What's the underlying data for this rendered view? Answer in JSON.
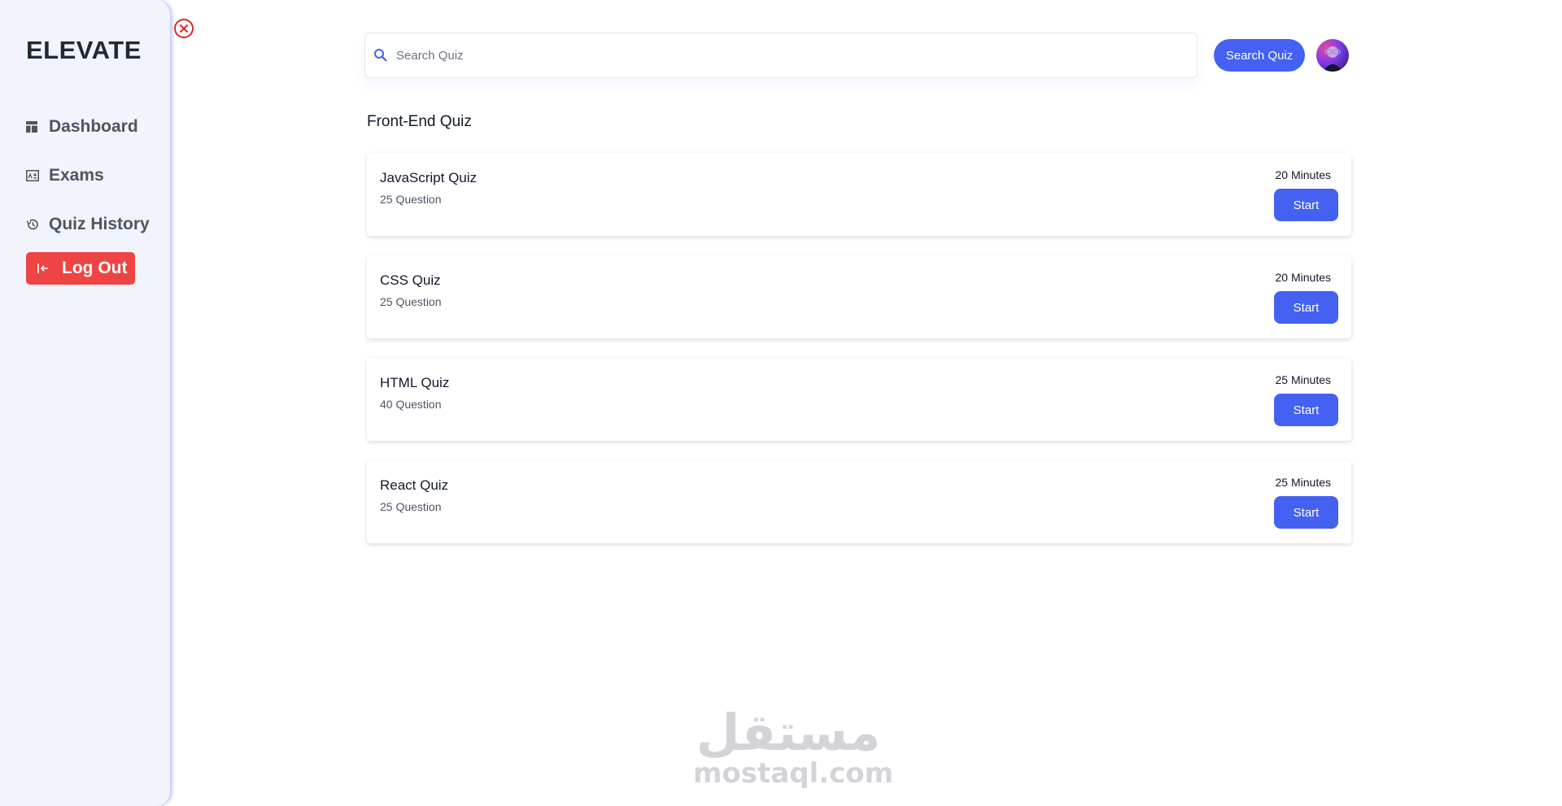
{
  "sidebar": {
    "logo": "ELEVATE",
    "items": [
      {
        "label": "Dashboard",
        "icon": "dashboard-icon"
      },
      {
        "label": "Exams",
        "icon": "exams-icon"
      },
      {
        "label": "Quiz History",
        "icon": "history-icon"
      }
    ],
    "logout": {
      "label": "Log Out",
      "icon": "logout-icon"
    }
  },
  "header": {
    "search_placeholder": "Search Quiz",
    "search_value": "",
    "search_button": "Search Quiz",
    "close_icon": "close-circle-icon"
  },
  "main": {
    "section_title": "Front-End Quiz",
    "quizzes": [
      {
        "name": "JavaScript Quiz",
        "questions": "25 Question",
        "duration": "20 Minutes",
        "action": "Start"
      },
      {
        "name": "CSS Quiz",
        "questions": "25 Question",
        "duration": "20 Minutes",
        "action": "Start"
      },
      {
        "name": "HTML Quiz",
        "questions": "40 Question",
        "duration": "25 Minutes",
        "action": "Start"
      },
      {
        "name": "React Quiz",
        "questions": "25 Question",
        "duration": "25 Minutes",
        "action": "Start"
      }
    ]
  },
  "watermark": {
    "arabic": "مستقل",
    "latin": "mostaql.com"
  },
  "colors": {
    "primary": "#4461f2",
    "danger": "#ef4444",
    "sidebar_bg": "#f1f4fa",
    "close_icon": "#dc2626"
  }
}
